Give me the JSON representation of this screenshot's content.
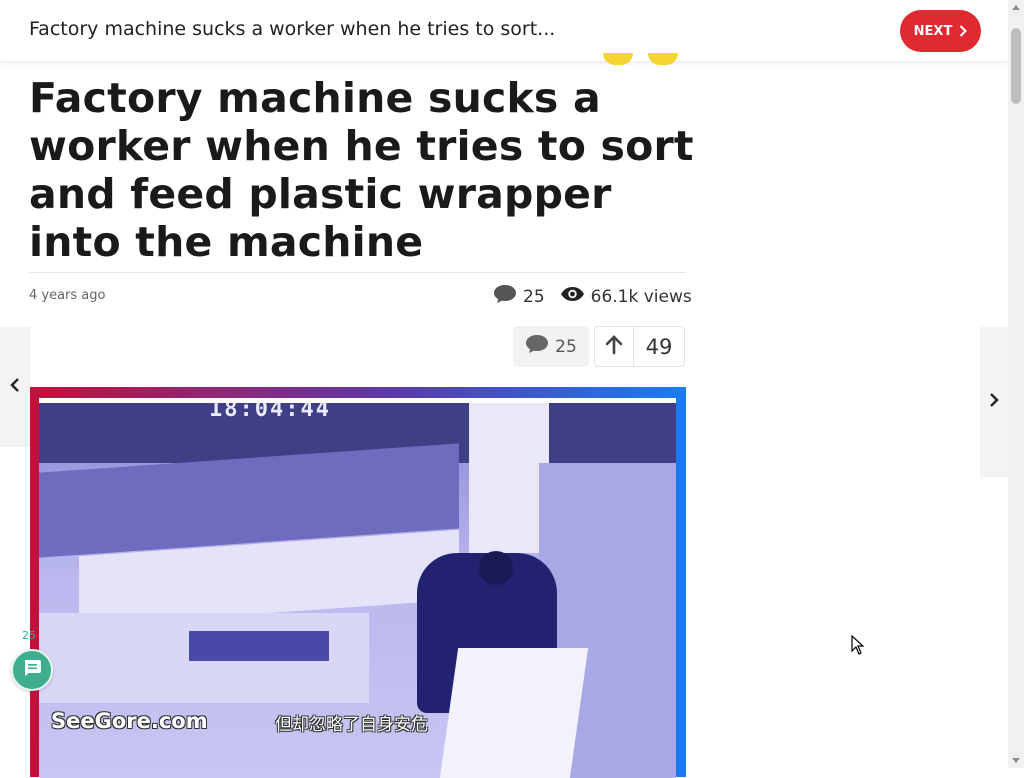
{
  "topbar": {
    "title": "Factory machine sucks a worker when he tries to sort...",
    "next_label": "NEXT"
  },
  "article": {
    "headline": "Factory machine sucks a worker when he tries to sort and feed plastic wrapper into the machine",
    "posted": "4 years ago",
    "comment_count": "25",
    "views": "66.1k views"
  },
  "actions": {
    "comment_count": "25",
    "vote_count": "49"
  },
  "media": {
    "timestamp": "18:04:44",
    "watermark": "SeeGore.com",
    "subtitle": "但却忽略了自身安危"
  },
  "floating": {
    "count": "25"
  },
  "colors": {
    "accent_red": "#e12a2f",
    "chat_green": "#3fae8f"
  },
  "icons": {
    "next": "chevron-right-icon",
    "comment": "speech-bubble-icon",
    "views": "eye-icon",
    "upvote": "arrow-up-icon",
    "prev_post": "chevron-left-icon",
    "next_post": "chevron-right-icon",
    "chat": "chat-bubble-icon"
  }
}
